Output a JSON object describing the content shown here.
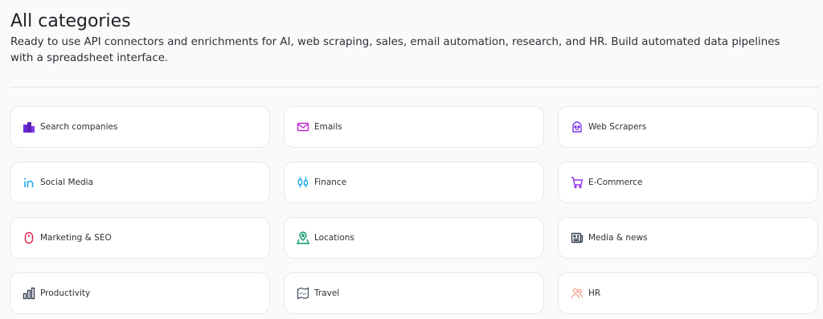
{
  "header": {
    "title": "All categories",
    "subtitle": "Ready to use API connectors and enrichments for AI, web scraping, sales, email automation, research, and HR. Build automated data pipelines with a spreadsheet interface."
  },
  "categories": [
    {
      "label": "Search companies",
      "icon": "buildings-icon",
      "color": "#6a2bd9"
    },
    {
      "label": "Emails",
      "icon": "envelope-icon",
      "color": "#c026d3"
    },
    {
      "label": "Web Scrapers",
      "icon": "robot-icon",
      "color": "#7c3aed"
    },
    {
      "label": "Social Media",
      "icon": "linkedin-icon",
      "color": "#0ea5e9"
    },
    {
      "label": "Finance",
      "icon": "candlestick-icon",
      "color": "#0ea5e9"
    },
    {
      "label": "E-Commerce",
      "icon": "cart-icon",
      "color": "#9333ea"
    },
    {
      "label": "Marketing & SEO",
      "icon": "mouse-icon",
      "color": "#e11d48"
    },
    {
      "label": "Locations",
      "icon": "map-pin-icon",
      "color": "#059669"
    },
    {
      "label": "Media & news",
      "icon": "newspaper-icon",
      "color": "#374151"
    },
    {
      "label": "Productivity",
      "icon": "bar-chart-icon",
      "color": "#374151"
    },
    {
      "label": "Travel",
      "icon": "map-icon",
      "color": "#4b5563"
    },
    {
      "label": "HR",
      "icon": "users-icon",
      "color": "#f59e8b"
    }
  ]
}
